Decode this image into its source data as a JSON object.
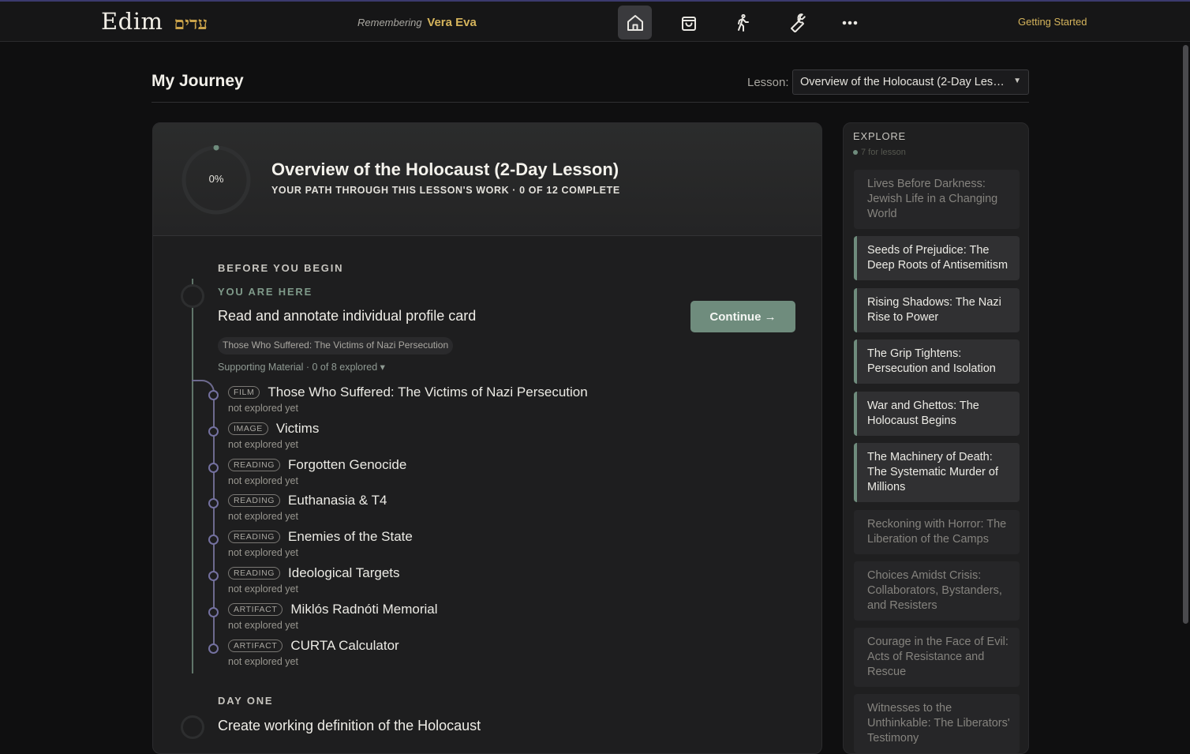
{
  "nav": {
    "brand_latin": "Edim",
    "brand_hebrew": "עדים",
    "remembering_prefix": "Remembering",
    "remembering_name": "Vera Eva",
    "icons": [
      "home-icon",
      "bag-icon",
      "walking-person-icon",
      "wrench-icon",
      "more-icon"
    ],
    "active_icon": "home-icon",
    "getting_started": "Getting Started"
  },
  "page": {
    "title": "My Journey",
    "lesson_label": "Lesson:",
    "lesson_selected": "Overview of the Holocaust (2-Day Lesson)"
  },
  "lesson": {
    "progress_percent": 0,
    "progress_text": "0%",
    "title": "Overview of the Holocaust (2-Day Lesson)",
    "subtitle": "YOUR PATH THROUGH THIS LESSON'S WORK · 0 OF 12 COMPLETE"
  },
  "sections": [
    {
      "label": "BEFORE YOU BEGIN",
      "here_label": "YOU ARE HERE",
      "task": "Read and annotate individual profile card",
      "continue_label": "Continue →",
      "source_chip": "Those Who Suffered: The Victims of Nazi Persecution",
      "support_toggle": "Supporting Material · 0 of 8 explored ▾",
      "materials": [
        {
          "tag": "FILM",
          "title": "Those Who Suffered: The Victims of Nazi Persecution",
          "status": "not explored yet"
        },
        {
          "tag": "IMAGE",
          "title": "Victims",
          "status": "not explored yet"
        },
        {
          "tag": "READING",
          "title": "Forgotten Genocide",
          "status": "not explored yet"
        },
        {
          "tag": "READING",
          "title": "Euthanasia & T4",
          "status": "not explored yet"
        },
        {
          "tag": "READING",
          "title": "Enemies of the State",
          "status": "not explored yet"
        },
        {
          "tag": "READING",
          "title": "Ideological Targets",
          "status": "not explored yet"
        },
        {
          "tag": "ARTIFACT",
          "title": "Miklós Radnóti Memorial",
          "status": "not explored yet"
        },
        {
          "tag": "ARTIFACT",
          "title": "CURTA Calculator",
          "status": "not explored yet"
        }
      ]
    },
    {
      "label": "DAY ONE",
      "task": "Create working definition of the Holocaust"
    }
  ],
  "explore": {
    "title": "EXPLORE",
    "subtitle": "7 for lesson",
    "items": [
      {
        "label": "Lives Before Darkness: Jewish Life in a Changing World",
        "highlighted": false
      },
      {
        "label": "Seeds of Prejudice: The Deep Roots of Antisemitism",
        "highlighted": true
      },
      {
        "label": "Rising Shadows: The Nazi Rise to Power",
        "highlighted": true
      },
      {
        "label": "The Grip Tightens: Persecution and Isolation",
        "highlighted": true
      },
      {
        "label": "War and Ghettos: The Holocaust Begins",
        "highlighted": true
      },
      {
        "label": "The Machinery of Death: The Systematic Murder of Millions",
        "highlighted": true
      },
      {
        "label": "Reckoning with Horror: The Liberation of the Camps",
        "highlighted": false
      },
      {
        "label": "Choices Amidst Crisis: Collaborators, Bystanders, and Resisters",
        "highlighted": false
      },
      {
        "label": "Courage in the Face of Evil: Acts of Resistance and Rescue",
        "highlighted": false
      },
      {
        "label": "Witnesses to the Unthinkable: The Liberators' Testimony",
        "highlighted": false
      }
    ]
  },
  "colors": {
    "accent_green": "#6f8c7d",
    "accent_gold": "#d5b45c",
    "branch_purple": "#6d6a8e"
  }
}
